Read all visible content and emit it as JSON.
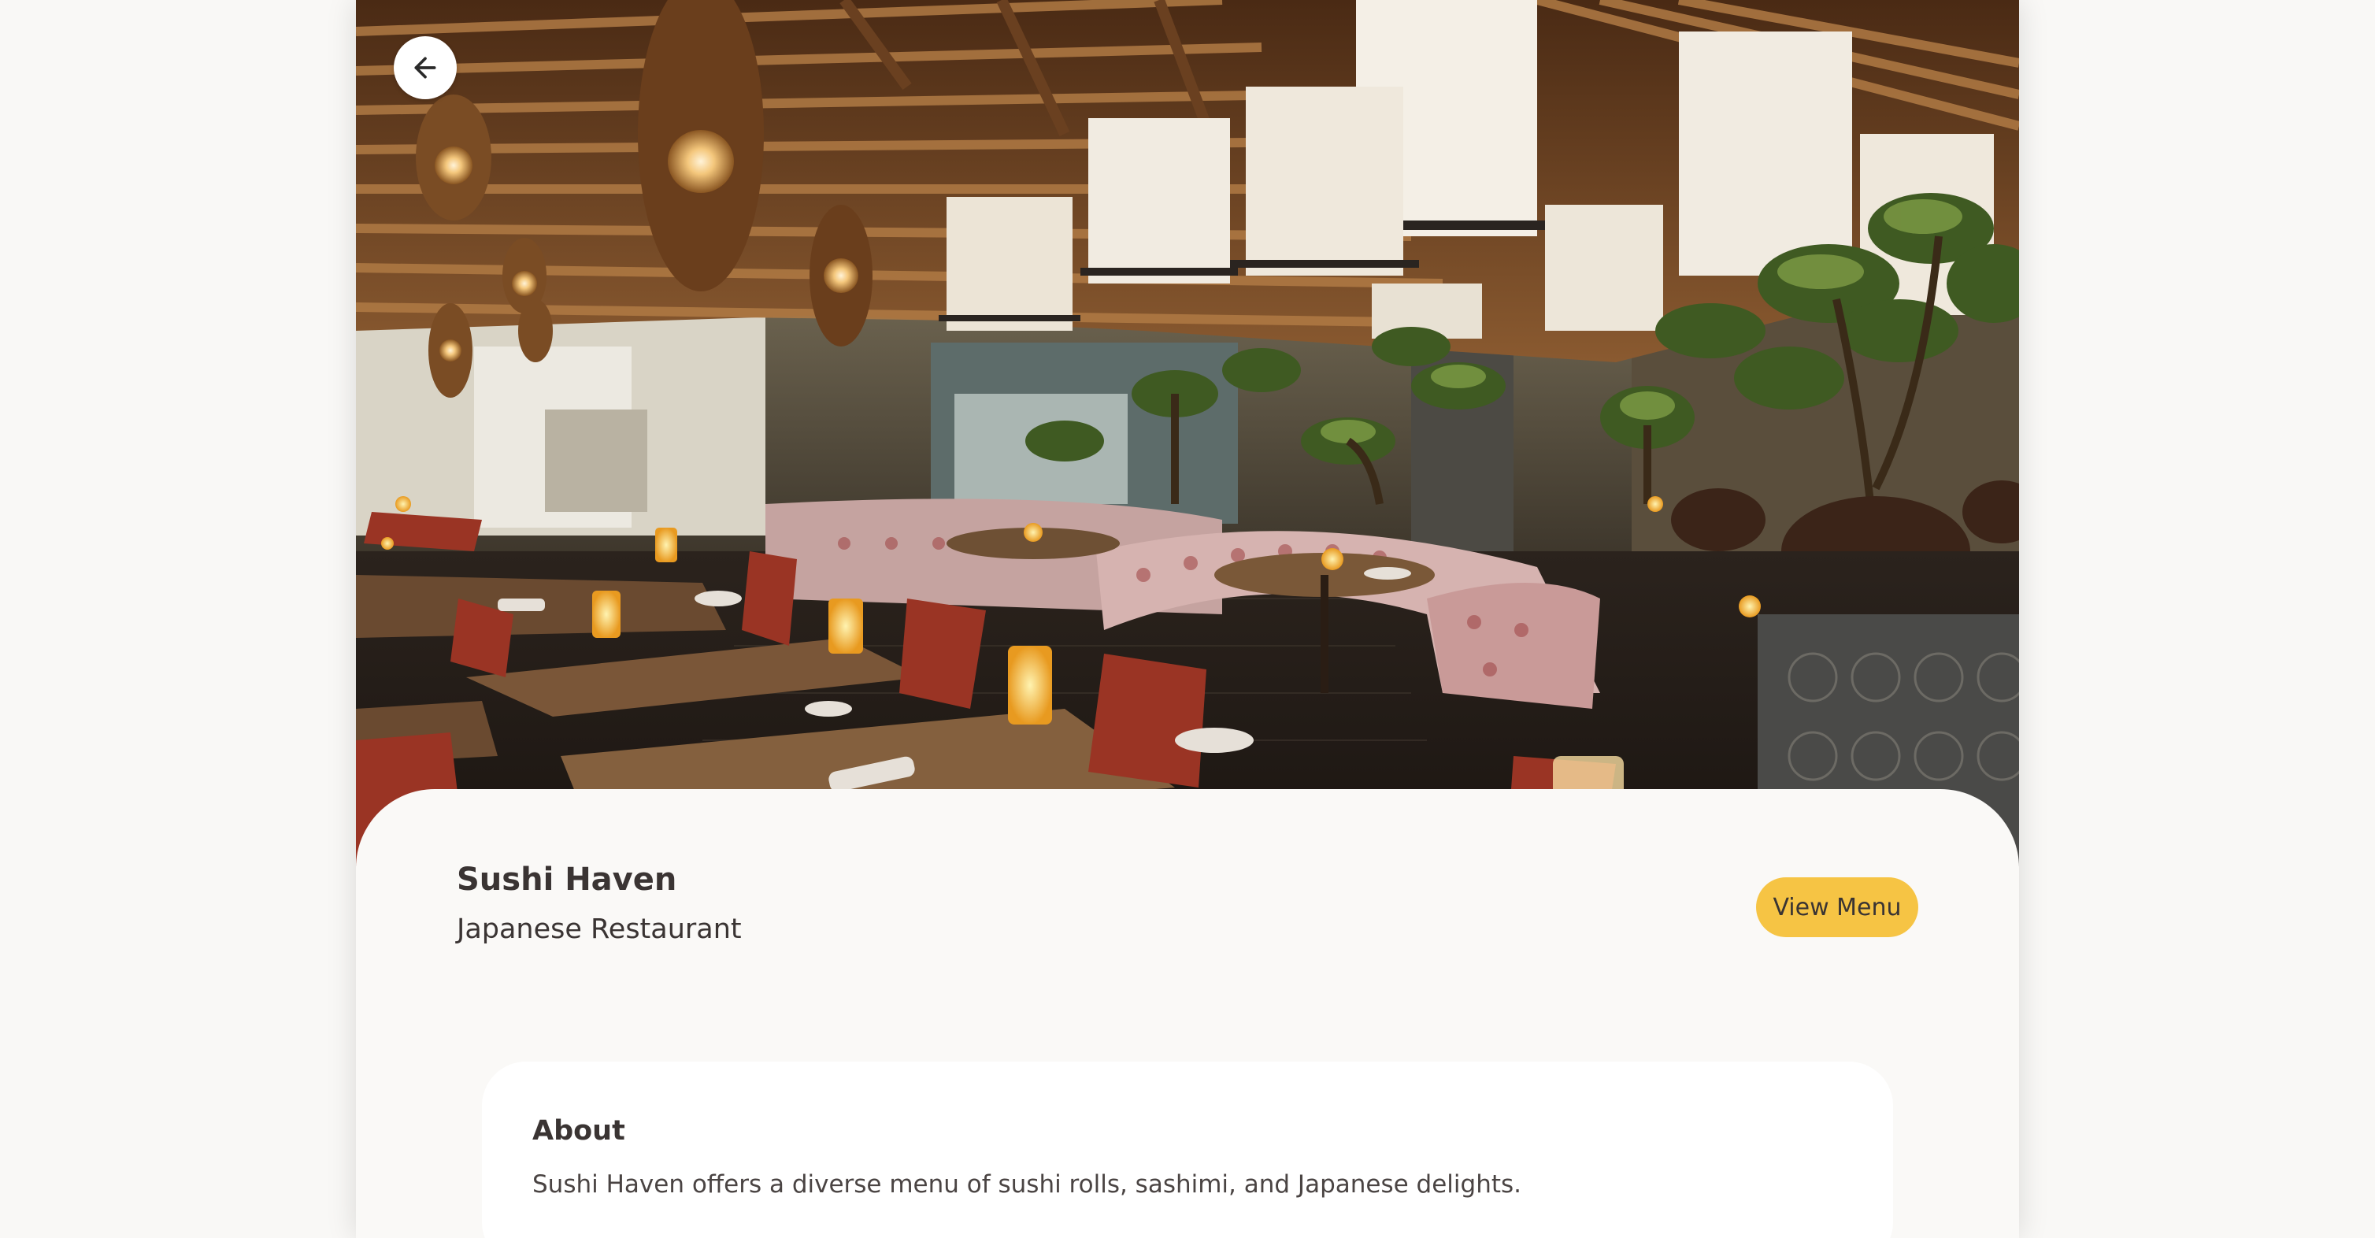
{
  "header": {
    "back_icon": "arrow-left-icon"
  },
  "restaurant": {
    "name": "Sushi Haven",
    "type": "Japanese Restaurant",
    "view_menu_label": "View Menu"
  },
  "about": {
    "title": "About",
    "text": "Sushi Haven offers a diverse menu of sushi rolls, sashimi, and Japanese delights."
  },
  "colors": {
    "accent": "#f6c444",
    "text": "#3a3433",
    "background": "#faf9f7"
  }
}
